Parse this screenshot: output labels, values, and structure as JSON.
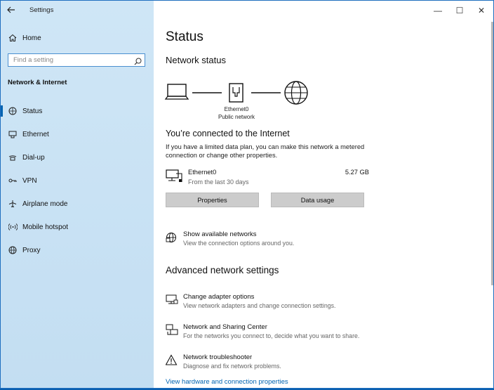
{
  "window": {
    "app_title": "Settings",
    "controls": {
      "minimize": "—",
      "maximize": "☐",
      "close": "✕"
    }
  },
  "sidebar": {
    "home_label": "Home",
    "search_placeholder": "Find a setting",
    "section_title": "Network & Internet",
    "active_item": "Status",
    "items": [
      {
        "label": "Status",
        "icon": "status-globe-icon"
      },
      {
        "label": "Ethernet",
        "icon": "ethernet-icon"
      },
      {
        "label": "Dial-up",
        "icon": "dialup-icon"
      },
      {
        "label": "VPN",
        "icon": "vpn-icon"
      },
      {
        "label": "Airplane mode",
        "icon": "airplane-icon"
      },
      {
        "label": "Mobile hotspot",
        "icon": "hotspot-icon"
      },
      {
        "label": "Proxy",
        "icon": "globe-icon"
      }
    ]
  },
  "main": {
    "page_title": "Status",
    "network_status_heading": "Network status",
    "diagram": {
      "adapter_name": "Ethernet0",
      "network_type": "Public network"
    },
    "connected_heading": "You’re connected to the Internet",
    "connected_desc": "If you have a limited data plan, you can make this network a metered connection or change other properties.",
    "adapter": {
      "name": "Ethernet0",
      "period": "From the last 30 days",
      "usage": "5.27 GB"
    },
    "buttons": {
      "properties": "Properties",
      "data_usage": "Data usage"
    },
    "show_networks": {
      "title": "Show available networks",
      "subtitle": "View the connection options around you."
    },
    "advanced_heading": "Advanced network settings",
    "advanced_items": [
      {
        "title": "Change adapter options",
        "subtitle": "View network adapters and change connection settings.",
        "icon": "adapter-icon"
      },
      {
        "title": "Network and Sharing Center",
        "subtitle": "For the networks you connect to, decide what you want to share.",
        "icon": "sharing-center-icon"
      },
      {
        "title": "Network troubleshooter",
        "subtitle": "Diagnose and fix network problems.",
        "icon": "warning-icon"
      }
    ],
    "hardware_link": "View hardware and connection properties"
  },
  "colors": {
    "accent": "#0063b1",
    "sidebar_bg": "#c9e2f4",
    "button_bg": "#cccccc"
  }
}
